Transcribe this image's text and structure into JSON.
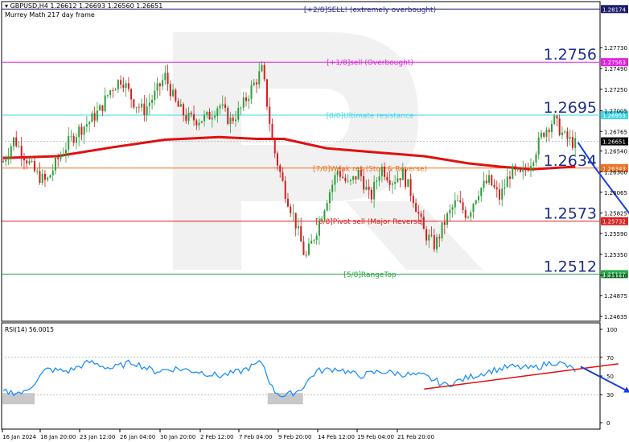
{
  "header": {
    "symbol_line": "GBPUSD,H4  1.26612 1.26693 1.26560 1.26651",
    "indicator_line": "Murrey Math 217 day frame"
  },
  "rsi_label": "RSI(14) 56.0015",
  "colors": {
    "candle_up": "#2e9e3a",
    "candle_down": "#d81b1b",
    "ma": "#e01010",
    "rsi": "#1e90ff",
    "arrow": "#1a3fe0",
    "watermark": "#e6e6e6",
    "level_big_text": "#1f2e8a"
  },
  "murrey_levels": [
    {
      "price": 1.28174,
      "label": "[+2/8]SELL! (extremely overbought)",
      "axis_label": "1.28174",
      "big_label": "",
      "color": "#1b1d6e",
      "label_color": "#2c2c8c"
    },
    {
      "price": 1.27563,
      "label": "[+1/8]sell (Overbought)",
      "axis_label": "1.27563",
      "big_label": "1.2756",
      "color": "#e020e0",
      "label_color": "#e020e0"
    },
    {
      "price": 1.26953,
      "label": "[8/8]Ultimate resistance",
      "axis_label": "1.26953",
      "big_label": "1.2695",
      "color": "#3fd7ea",
      "label_color": "#3fd7ea"
    },
    {
      "price": 1.26343,
      "label": "[7/8]Weak res (Stop & Reverse)",
      "axis_label": "1.26343",
      "big_label": "1.2634",
      "color": "#f07020",
      "label_color": "#f07020"
    },
    {
      "price": 1.25732,
      "label": "[6/8]Pivot sell (Major Reverse)",
      "axis_label": "1.25732",
      "big_label": "1.2573",
      "color": "#e02020",
      "label_color": "#e02020"
    },
    {
      "price": 1.25122,
      "label": "[5/8]RangeTop",
      "axis_label": "1.25122",
      "big_label": "1.2512",
      "color": "#27a847",
      "label_color": "#27a847"
    }
  ],
  "current_price": {
    "price": 1.26651,
    "axis_label": "1.26651"
  },
  "price_axis": {
    "min": 1.2458,
    "max": 1.2826,
    "ticks": [
      "1.27730",
      "1.27490",
      "1.27250",
      "1.27005",
      "1.26765",
      "1.26540",
      "1.26300",
      "1.26065",
      "1.25825",
      "1.25590",
      "1.25350",
      "1.25110",
      "1.24875",
      "1.24635"
    ]
  },
  "rsi_axis": {
    "min": 0,
    "max": 100,
    "ticks": [
      "100",
      "70",
      "50",
      "30",
      "0"
    ]
  },
  "time_axis": [
    "16 Jan 2024",
    "18 Jan 20:00",
    "23 Jan 12:00",
    "26 Jan 04:00",
    "30 Jan 20:00",
    "2 Feb 12:00",
    "7 Feb 04:00",
    "9 Feb 20:00",
    "14 Feb 12:00",
    "19 Feb 04:00",
    "21 Feb 20:00"
  ],
  "chart_data": {
    "type": "candlestick",
    "symbol": "GBPUSD",
    "timeframe": "H4",
    "ohlc_last": {
      "open": 1.26612,
      "high": 1.26693,
      "low": 1.2656,
      "close": 1.26651
    },
    "close_path": [
      [
        0,
        1.2642
      ],
      [
        2,
        1.2668
      ],
      [
        4,
        1.2648
      ],
      [
        6,
        1.2628
      ],
      [
        8,
        1.2618
      ],
      [
        10,
        1.2643
      ],
      [
        12,
        1.2663
      ],
      [
        14,
        1.2678
      ],
      [
        16,
        1.2688
      ],
      [
        18,
        1.2702
      ],
      [
        20,
        1.2726
      ],
      [
        22,
        1.2738
      ],
      [
        24,
        1.2712
      ],
      [
        26,
        1.27
      ],
      [
        28,
        1.2718
      ],
      [
        30,
        1.274
      ],
      [
        32,
        1.2708
      ],
      [
        34,
        1.2692
      ],
      [
        36,
        1.269
      ],
      [
        38,
        1.2693
      ],
      [
        40,
        1.2708
      ],
      [
        42,
        1.2688
      ],
      [
        44,
        1.2702
      ],
      [
        46,
        1.2726
      ],
      [
        48,
        1.2748
      ],
      [
        50,
        1.266
      ],
      [
        52,
        1.2612
      ],
      [
        54,
        1.2575
      ],
      [
        56,
        1.253
      ],
      [
        58,
        1.2562
      ],
      [
        60,
        1.26
      ],
      [
        62,
        1.2632
      ],
      [
        64,
        1.2614
      ],
      [
        66,
        1.263
      ],
      [
        68,
        1.2598
      ],
      [
        70,
        1.2636
      ],
      [
        72,
        1.262
      ],
      [
        74,
        1.2628
      ],
      [
        76,
        1.26
      ],
      [
        78,
        1.256
      ],
      [
        80,
        1.2545
      ],
      [
        82,
        1.2575
      ],
      [
        84,
        1.2596
      ],
      [
        86,
        1.258
      ],
      [
        88,
        1.2608
      ],
      [
        90,
        1.262
      ],
      [
        92,
        1.26
      ],
      [
        94,
        1.263
      ],
      [
        96,
        1.2625
      ],
      [
        98,
        1.2645
      ],
      [
        100,
        1.2675
      ],
      [
        102,
        1.269
      ],
      [
        104,
        1.267
      ],
      [
        106,
        1.2662
      ]
    ],
    "ma": {
      "name": "",
      "values": [
        [
          0,
          1.2646
        ],
        [
          10,
          1.2648
        ],
        [
          20,
          1.2658
        ],
        [
          30,
          1.2667
        ],
        [
          40,
          1.267
        ],
        [
          47,
          1.2668
        ],
        [
          52,
          1.2668
        ],
        [
          60,
          1.2657
        ],
        [
          70,
          1.2652
        ],
        [
          78,
          1.2648
        ],
        [
          86,
          1.264
        ],
        [
          92,
          1.2636
        ],
        [
          98,
          1.2633
        ],
        [
          106,
          1.2636
        ]
      ]
    },
    "rsi": {
      "period": 14,
      "last": 56.0015,
      "values": [
        [
          0,
          33
        ],
        [
          4,
          32
        ],
        [
          8,
          57
        ],
        [
          12,
          55
        ],
        [
          16,
          65
        ],
        [
          20,
          58
        ],
        [
          24,
          65
        ],
        [
          28,
          55
        ],
        [
          32,
          58
        ],
        [
          36,
          55
        ],
        [
          40,
          50
        ],
        [
          44,
          55
        ],
        [
          48,
          65
        ],
        [
          50,
          35
        ],
        [
          52,
          28
        ],
        [
          55,
          35
        ],
        [
          58,
          55
        ],
        [
          62,
          58
        ],
        [
          66,
          50
        ],
        [
          70,
          55
        ],
        [
          74,
          52
        ],
        [
          78,
          50
        ],
        [
          82,
          40
        ],
        [
          86,
          48
        ],
        [
          90,
          55
        ],
        [
          94,
          60
        ],
        [
          98,
          58
        ],
        [
          102,
          65
        ],
        [
          104,
          62
        ],
        [
          106,
          56
        ]
      ],
      "levels": [
        30,
        70
      ]
    },
    "x_range": [
      0,
      110
    ],
    "ylim": [
      1.2458,
      1.2826
    ],
    "rsi_ylim": [
      0,
      100
    ],
    "trendline": {
      "start": [
        78,
        36
      ],
      "end": [
        114,
        63
      ]
    },
    "projection_arrows": [
      {
        "from_price": 1.2664,
        "to_price": 1.2574
      },
      {
        "from_rsi": 60,
        "to_rsi": 33
      }
    ]
  }
}
